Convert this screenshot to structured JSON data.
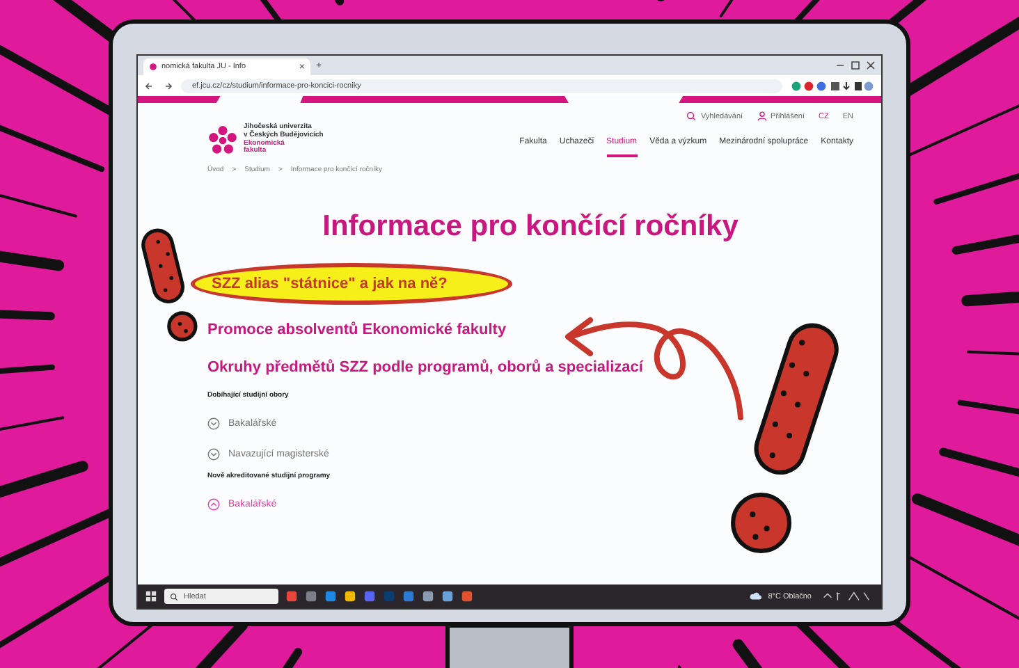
{
  "browser": {
    "tab": {
      "title": "nomická fakulta JU - Info",
      "close": "×"
    },
    "new_tab": "+",
    "url": "ef.jcu.cz/cz/studium/informace-pro-koncici-rocniky"
  },
  "header": {
    "logo": [
      {
        "text": "Jihočeská univerzita",
        "accent": false
      },
      {
        "text": "v Českých Budějovicích",
        "accent": false
      },
      {
        "text": "Ekonomická",
        "accent": true
      },
      {
        "text": "fakulta",
        "accent": true
      }
    ],
    "utility": [
      {
        "kind": "search",
        "label": "Vyhledávání"
      },
      {
        "kind": "user",
        "label": "Přihlášení"
      }
    ],
    "languages": [
      {
        "label": "CZ",
        "selected": true
      },
      {
        "label": "EN",
        "selected": false
      }
    ],
    "nav": [
      {
        "label": "Fakulta",
        "selected": false
      },
      {
        "label": "Uchazeči",
        "selected": false
      },
      {
        "label": "Studium",
        "selected": true
      },
      {
        "label": "Věda a výzkum",
        "selected": false
      },
      {
        "label": "Mezinárodní spolupráce",
        "selected": false
      },
      {
        "label": "Kontakty",
        "selected": false
      }
    ]
  },
  "breadcrumb": {
    "separator": ">",
    "items": [
      "Úvod",
      "Studium",
      "Informace pro končící ročníky"
    ]
  },
  "title": "Informace pro končící ročníky",
  "links": [
    {
      "label": "SZZ alias \"státnice\" a jak na ně?",
      "highlighted": true
    },
    {
      "label": "Promoce absolventů Ekonomické fakulty",
      "highlighted": false
    },
    {
      "label": "Okruhy předmětů SZZ podle programů, oborů a specializací",
      "highlighted": false
    }
  ],
  "sections": [
    {
      "heading": "Dobíhající studijní obory",
      "items": [
        {
          "label": "Bakalářské",
          "expanded": false
        },
        {
          "label": "Navazující magisterské",
          "expanded": false
        }
      ]
    },
    {
      "heading": "Nově akreditované studijní programy",
      "items": [
        {
          "label": "Bakalářské",
          "expanded": true
        }
      ]
    }
  ],
  "taskbar": {
    "search_placeholder": "Hledat",
    "weather": "8°C Oblačno"
  }
}
